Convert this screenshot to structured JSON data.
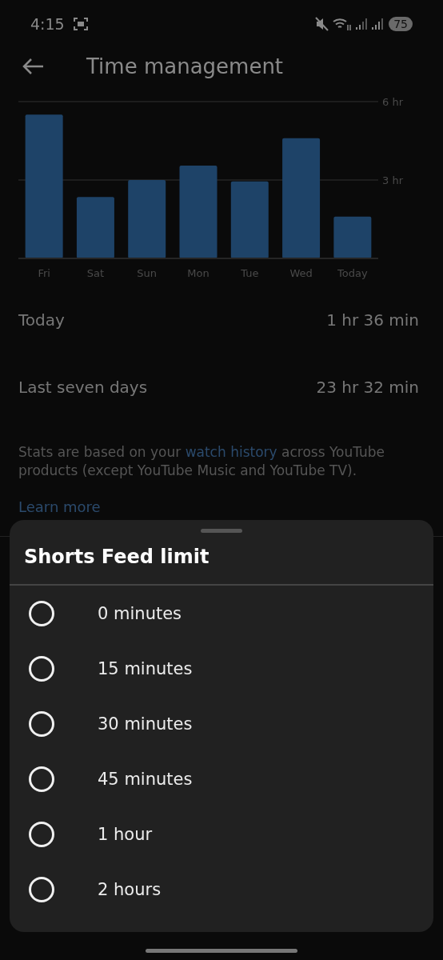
{
  "status_bar": {
    "time": "4:15",
    "battery": "75"
  },
  "header": {
    "title": "Time management"
  },
  "chart": {
    "chart_data": {
      "type": "bar",
      "categories": [
        "Fri",
        "Sat",
        "Sun",
        "Mon",
        "Tue",
        "Wed",
        "Today"
      ],
      "values": [
        5.5,
        2.35,
        3.0,
        3.55,
        2.95,
        4.6,
        1.6
      ],
      "ylim": [
        0,
        6
      ],
      "yticks": [
        {
          "value": 3,
          "label": "3 hr"
        },
        {
          "value": 6,
          "label": "6 hr"
        }
      ]
    }
  },
  "stats": [
    {
      "label": "Today",
      "value": "1 hr 36 min"
    },
    {
      "label": "Last seven days",
      "value": "23 hr 32 min"
    }
  ],
  "note": {
    "text": "Stats are based on your",
    "link": "watch history",
    "rest": "across YouTube products (except YouTube Music and YouTube TV)."
  },
  "learn_more": "Learn more",
  "sheet": {
    "title": "Shorts Feed limit",
    "options": [
      {
        "label": "0 minutes",
        "selected": false
      },
      {
        "label": "15 minutes",
        "selected": false
      },
      {
        "label": "30 minutes",
        "selected": false
      },
      {
        "label": "45 minutes",
        "selected": false
      },
      {
        "label": "1 hour",
        "selected": false
      },
      {
        "label": "2 hours",
        "selected": false
      }
    ]
  }
}
